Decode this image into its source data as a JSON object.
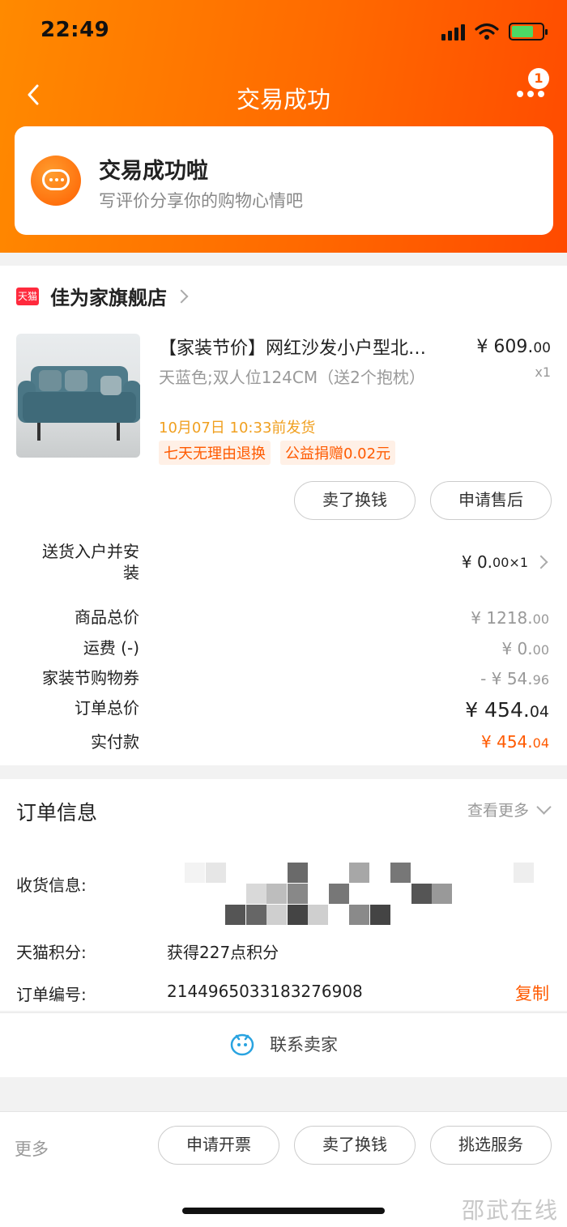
{
  "status_bar": {
    "time": "22:49"
  },
  "nav": {
    "title": "交易成功",
    "badge": "1"
  },
  "success_card": {
    "title": "交易成功啦",
    "subtitle": "写评价分享你的购物心情吧"
  },
  "shop": {
    "tag": "天猫",
    "name": "佳为家旗舰店"
  },
  "product": {
    "title": "【家装节价】网红沙发小户型北…",
    "price_int": "¥ 609.",
    "price_dec": "00",
    "qty": "x1",
    "spec": "天蓝色;双人位124CM（送2个抱枕）",
    "ship_time": "10月07日 10:33前发货",
    "tags": [
      "七天无理由退换",
      "公益捐赠0.02元"
    ]
  },
  "item_buttons": {
    "resell": "卖了换钱",
    "after_sale": "申请售后"
  },
  "service": {
    "label": "送货入户并安装",
    "value_int": "¥ 0.",
    "value_dec": "00",
    "qty": " ×1"
  },
  "fees": [
    {
      "label": "商品总价",
      "value_int": "¥ 1218.",
      "value_dec": "00"
    },
    {
      "label": "运费 (-)",
      "value_int": "¥ 0.",
      "value_dec": "00"
    },
    {
      "label": "家装节购物券",
      "value_int": "- ¥ 54.",
      "value_dec": "96"
    },
    {
      "label": "订单总价",
      "value_int": "¥ 454.",
      "value_dec": "04"
    },
    {
      "label": "实付款",
      "value_int": "¥ 454.",
      "value_dec": "04"
    }
  ],
  "order_info": {
    "title": "订单信息",
    "more": "查看更多",
    "address_label": "收货信息:",
    "points_label": "天猫积分:",
    "points_value": "获得227点积分",
    "order_no_label": "订单编号:",
    "order_no": "2144965033183276908",
    "copy": "复制"
  },
  "contact": {
    "label": "联系卖家"
  },
  "bottom_bar": {
    "more": "更多",
    "invoice": "申请开票",
    "resell": "卖了换钱",
    "service": "挑选服务"
  },
  "watermark": "邵武在线",
  "colors": {
    "accent": "#ff5a00",
    "header_start": "#ff8a00",
    "header_end": "#ff4a00"
  }
}
